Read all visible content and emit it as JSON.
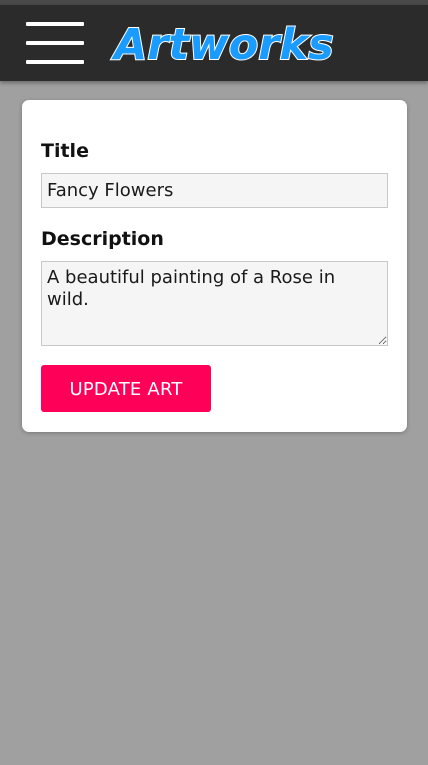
{
  "header": {
    "menu_icon": "hamburger-menu-icon",
    "logo_text": "Artworks",
    "background": "#2b2b2b",
    "logo_color": "#1a9bff"
  },
  "form": {
    "title_label": "Title",
    "title_value": "Fancy Flowers",
    "description_label": "Description",
    "description_value": "A beautiful painting of a Rose in wild.",
    "submit_label": "UPDATE ART",
    "submit_color": "#ff0058"
  },
  "page": {
    "background": "#a0a0a0"
  }
}
